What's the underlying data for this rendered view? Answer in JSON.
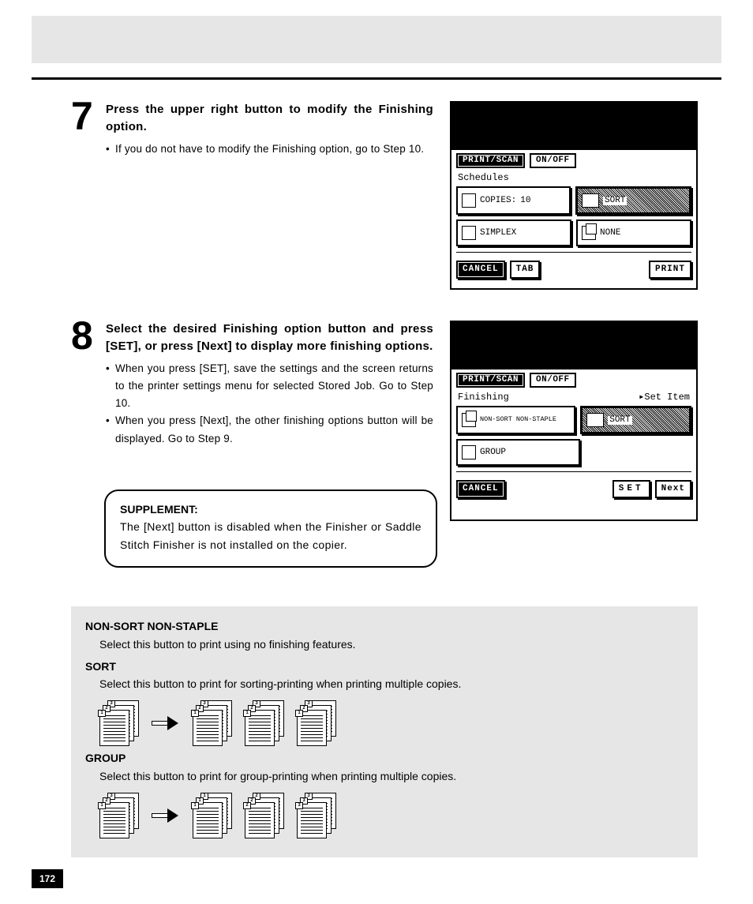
{
  "page_number": "172",
  "step7": {
    "num": "7",
    "heading": "Press the upper right button to modify the Finishing option.",
    "bullets": [
      "If you do not have to modify the Finishing option, go to Step 10."
    ],
    "lcd": {
      "print_scan": "PRINT/SCAN",
      "onoff": "ON/OFF",
      "subtitle": "Schedules",
      "copies_label": "COPIES:",
      "copies_value": "10",
      "sort": "SORT",
      "simplex": "SIMPLEX",
      "none": "NONE",
      "cancel": "CANCEL",
      "tab": "TAB",
      "print": "PRINT"
    }
  },
  "step8": {
    "num": "8",
    "heading": "Select the desired Finishing option button and press [SET], or press [Next] to display more finishing options.",
    "bullets": [
      "When you press [SET], save the settings and the screen returns to the printer settings menu for selected Stored Job.  Go to Step 10.",
      "When you press [Next], the other finishing options button will be displayed.  Go to Step 9."
    ],
    "lcd": {
      "print_scan": "PRINT/SCAN",
      "onoff": "ON/OFF",
      "subtitle_left": "Finishing",
      "subtitle_right": "▸Set Item",
      "nonsort": "NON-SORT NON-STAPLE",
      "sort": "SORT",
      "group": "GROUP",
      "cancel": "CANCEL",
      "set": "SET",
      "next": "Next"
    }
  },
  "supplement": {
    "title": "SUPPLEMENT:",
    "body": "The [Next] button is disabled when the Finisher or Saddle Stitch Finisher is not installed on the copier."
  },
  "defs": {
    "nonsort_t": "NON-SORT NON-STAPLE",
    "nonsort_d": "Select this button to print using no finishing features.",
    "sort_t": "SORT",
    "sort_d": "Select this button to print for sorting-printing when printing multiple copies.",
    "group_t": "GROUP",
    "group_d": "Select this button to print for group-printing when printing multiple copies."
  }
}
